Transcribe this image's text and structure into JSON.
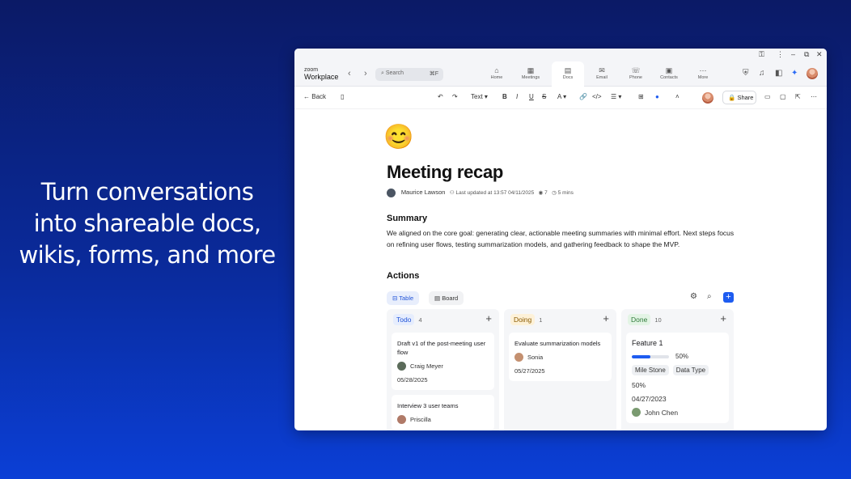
{
  "hero": {
    "text": "Turn conversations into shareable docs, wikis, forms, and more"
  },
  "app": {
    "brand_top": "zoom",
    "brand_bottom": "Workplace",
    "search_placeholder": "Search",
    "search_shortcut": "⌘F",
    "nav": [
      {
        "label": "Home",
        "icon": "home-icon"
      },
      {
        "label": "Meetings",
        "icon": "calendar-icon"
      },
      {
        "label": "Docs",
        "icon": "doc-icon",
        "active": true
      },
      {
        "label": "Email",
        "icon": "mail-icon"
      },
      {
        "label": "Phone",
        "icon": "phone-icon"
      },
      {
        "label": "Contacts",
        "icon": "contacts-icon"
      },
      {
        "label": "More",
        "icon": "more-icon"
      }
    ]
  },
  "toolbar": {
    "back_label": "Back",
    "text_style": "Text",
    "share_label": "Share"
  },
  "doc": {
    "emoji": "😊",
    "title": "Meeting recap",
    "author": "Maurice Lawson",
    "last_updated": "Last updated at 13:57 04/11/2025",
    "views": "7",
    "read_time": "5 mins",
    "summary_heading": "Summary",
    "summary_text": "We aligned on the core goal: generating clear, actionable meeting summaries with minimal effort. Next steps focus on refining user flows, testing summarization models, and gathering feedback to shape the MVP.",
    "actions_heading": "Actions",
    "view_tabs": [
      {
        "label": "Table",
        "active": true
      },
      {
        "label": "Board"
      }
    ]
  },
  "board": {
    "columns": [
      {
        "name": "Todo",
        "count": "4",
        "color": "#2355d8",
        "bg": "#e6edfd",
        "cards": [
          {
            "title": "Draft v1 of the post-meeting user flow",
            "person": "Craig Meyer",
            "date": "05/28/2025"
          },
          {
            "title": "Interview 3 user teams",
            "person": "Priscilla"
          }
        ]
      },
      {
        "name": "Doing",
        "count": "1",
        "color": "#8a5a00",
        "bg": "#fdf1d8",
        "cards": [
          {
            "title": "Evaluate summarization models",
            "person": "Sonia",
            "date": "05/27/2025"
          }
        ]
      },
      {
        "name": "Done",
        "count": "10",
        "color": "#2f7a3a",
        "bg": "#e3f4e5",
        "cards": [
          {
            "title": "Feature 1",
            "progress": 50,
            "progress_label": "50%",
            "tags": [
              "Mile Stone",
              "Data Type"
            ],
            "percent": "50%",
            "date": "04/27/2023",
            "person": "John Chen"
          }
        ]
      }
    ]
  }
}
